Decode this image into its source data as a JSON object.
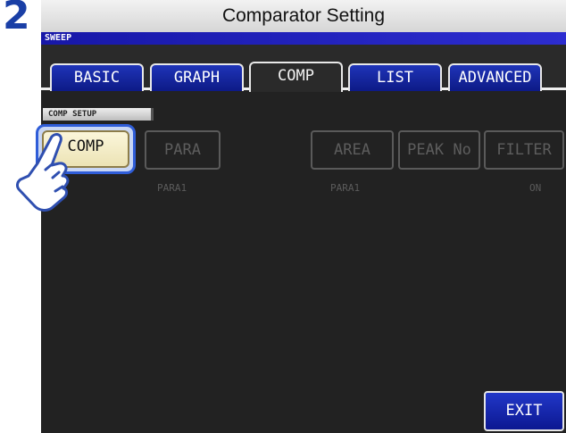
{
  "step_number": "2",
  "title": "Comparator Setting",
  "mode_label": "SWEEP",
  "tabs": [
    {
      "label": "BASIC"
    },
    {
      "label": "GRAPH"
    },
    {
      "label": "COMP"
    },
    {
      "label": "LIST"
    },
    {
      "label": "ADVANCED"
    }
  ],
  "section_label": "COMP SETUP",
  "buttons": {
    "comp": "COMP",
    "para": "PARA",
    "area": "AREA",
    "peak_no": "PEAK No",
    "filter": "FILTER",
    "exit": "EXIT"
  },
  "values": {
    "para": "PARA1",
    "area": "PARA1",
    "filter": "ON"
  },
  "colors": {
    "step_number": "#1a3fa6",
    "tab_blue": "#1f34b8",
    "screen_bg": "#222222",
    "selected_button": "#fbf6da",
    "highlight": "#2f5dd8"
  },
  "icons": {
    "pointer": "hand-pointer-icon"
  }
}
